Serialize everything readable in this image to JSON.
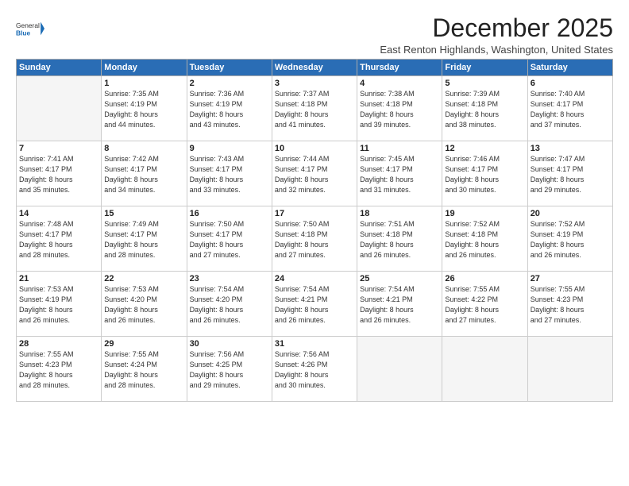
{
  "logo": {
    "general": "General",
    "blue": "Blue"
  },
  "title": "December 2025",
  "location": "East Renton Highlands, Washington, United States",
  "days_of_week": [
    "Sunday",
    "Monday",
    "Tuesday",
    "Wednesday",
    "Thursday",
    "Friday",
    "Saturday"
  ],
  "weeks": [
    [
      {
        "day": "",
        "info": ""
      },
      {
        "day": "1",
        "info": "Sunrise: 7:35 AM\nSunset: 4:19 PM\nDaylight: 8 hours\nand 44 minutes."
      },
      {
        "day": "2",
        "info": "Sunrise: 7:36 AM\nSunset: 4:19 PM\nDaylight: 8 hours\nand 43 minutes."
      },
      {
        "day": "3",
        "info": "Sunrise: 7:37 AM\nSunset: 4:18 PM\nDaylight: 8 hours\nand 41 minutes."
      },
      {
        "day": "4",
        "info": "Sunrise: 7:38 AM\nSunset: 4:18 PM\nDaylight: 8 hours\nand 39 minutes."
      },
      {
        "day": "5",
        "info": "Sunrise: 7:39 AM\nSunset: 4:18 PM\nDaylight: 8 hours\nand 38 minutes."
      },
      {
        "day": "6",
        "info": "Sunrise: 7:40 AM\nSunset: 4:17 PM\nDaylight: 8 hours\nand 37 minutes."
      }
    ],
    [
      {
        "day": "7",
        "info": "Sunrise: 7:41 AM\nSunset: 4:17 PM\nDaylight: 8 hours\nand 35 minutes."
      },
      {
        "day": "8",
        "info": "Sunrise: 7:42 AM\nSunset: 4:17 PM\nDaylight: 8 hours\nand 34 minutes."
      },
      {
        "day": "9",
        "info": "Sunrise: 7:43 AM\nSunset: 4:17 PM\nDaylight: 8 hours\nand 33 minutes."
      },
      {
        "day": "10",
        "info": "Sunrise: 7:44 AM\nSunset: 4:17 PM\nDaylight: 8 hours\nand 32 minutes."
      },
      {
        "day": "11",
        "info": "Sunrise: 7:45 AM\nSunset: 4:17 PM\nDaylight: 8 hours\nand 31 minutes."
      },
      {
        "day": "12",
        "info": "Sunrise: 7:46 AM\nSunset: 4:17 PM\nDaylight: 8 hours\nand 30 minutes."
      },
      {
        "day": "13",
        "info": "Sunrise: 7:47 AM\nSunset: 4:17 PM\nDaylight: 8 hours\nand 29 minutes."
      }
    ],
    [
      {
        "day": "14",
        "info": "Sunrise: 7:48 AM\nSunset: 4:17 PM\nDaylight: 8 hours\nand 28 minutes."
      },
      {
        "day": "15",
        "info": "Sunrise: 7:49 AM\nSunset: 4:17 PM\nDaylight: 8 hours\nand 28 minutes."
      },
      {
        "day": "16",
        "info": "Sunrise: 7:50 AM\nSunset: 4:17 PM\nDaylight: 8 hours\nand 27 minutes."
      },
      {
        "day": "17",
        "info": "Sunrise: 7:50 AM\nSunset: 4:18 PM\nDaylight: 8 hours\nand 27 minutes."
      },
      {
        "day": "18",
        "info": "Sunrise: 7:51 AM\nSunset: 4:18 PM\nDaylight: 8 hours\nand 26 minutes."
      },
      {
        "day": "19",
        "info": "Sunrise: 7:52 AM\nSunset: 4:18 PM\nDaylight: 8 hours\nand 26 minutes."
      },
      {
        "day": "20",
        "info": "Sunrise: 7:52 AM\nSunset: 4:19 PM\nDaylight: 8 hours\nand 26 minutes."
      }
    ],
    [
      {
        "day": "21",
        "info": "Sunrise: 7:53 AM\nSunset: 4:19 PM\nDaylight: 8 hours\nand 26 minutes."
      },
      {
        "day": "22",
        "info": "Sunrise: 7:53 AM\nSunset: 4:20 PM\nDaylight: 8 hours\nand 26 minutes."
      },
      {
        "day": "23",
        "info": "Sunrise: 7:54 AM\nSunset: 4:20 PM\nDaylight: 8 hours\nand 26 minutes."
      },
      {
        "day": "24",
        "info": "Sunrise: 7:54 AM\nSunset: 4:21 PM\nDaylight: 8 hours\nand 26 minutes."
      },
      {
        "day": "25",
        "info": "Sunrise: 7:54 AM\nSunset: 4:21 PM\nDaylight: 8 hours\nand 26 minutes."
      },
      {
        "day": "26",
        "info": "Sunrise: 7:55 AM\nSunset: 4:22 PM\nDaylight: 8 hours\nand 27 minutes."
      },
      {
        "day": "27",
        "info": "Sunrise: 7:55 AM\nSunset: 4:23 PM\nDaylight: 8 hours\nand 27 minutes."
      }
    ],
    [
      {
        "day": "28",
        "info": "Sunrise: 7:55 AM\nSunset: 4:23 PM\nDaylight: 8 hours\nand 28 minutes."
      },
      {
        "day": "29",
        "info": "Sunrise: 7:55 AM\nSunset: 4:24 PM\nDaylight: 8 hours\nand 28 minutes."
      },
      {
        "day": "30",
        "info": "Sunrise: 7:56 AM\nSunset: 4:25 PM\nDaylight: 8 hours\nand 29 minutes."
      },
      {
        "day": "31",
        "info": "Sunrise: 7:56 AM\nSunset: 4:26 PM\nDaylight: 8 hours\nand 30 minutes."
      },
      {
        "day": "",
        "info": ""
      },
      {
        "day": "",
        "info": ""
      },
      {
        "day": "",
        "info": ""
      }
    ]
  ]
}
